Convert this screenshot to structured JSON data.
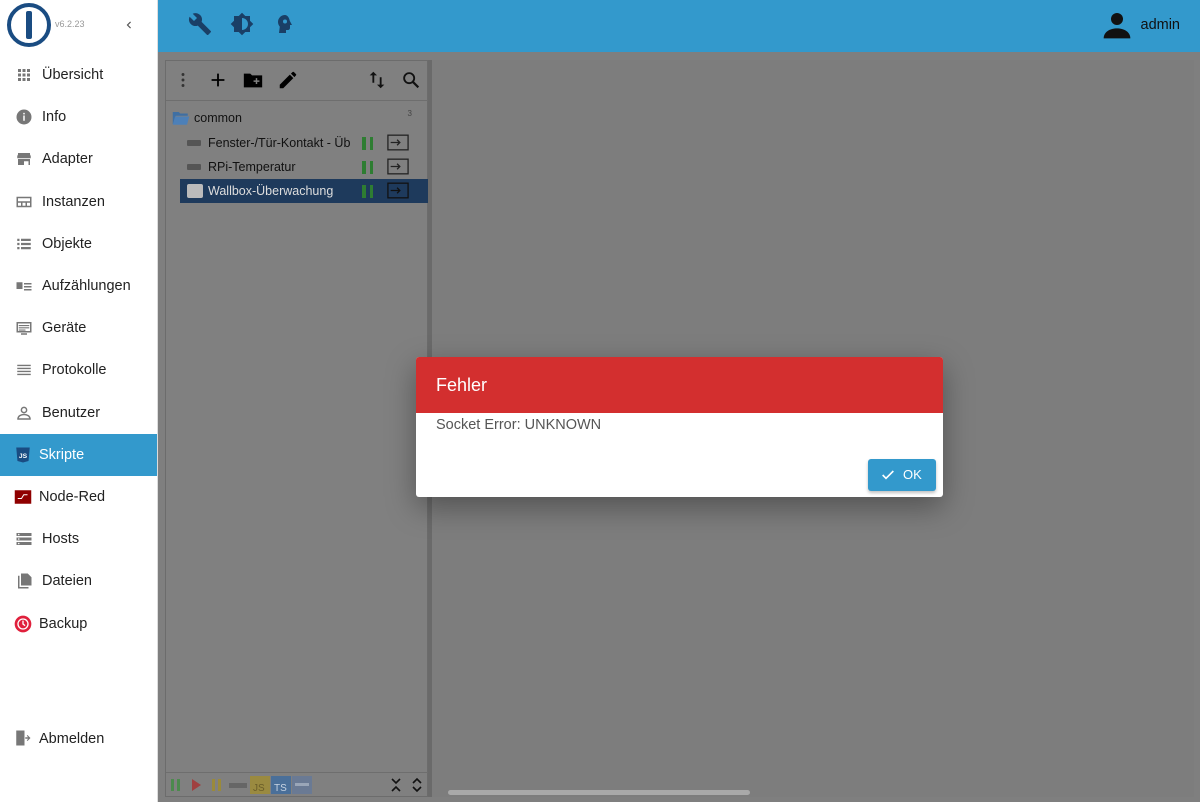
{
  "app": {
    "version": "v6.2.23"
  },
  "sidebar": {
    "items": [
      {
        "label": "Übersicht",
        "icon": "grid-icon"
      },
      {
        "label": "Info",
        "icon": "info-icon"
      },
      {
        "label": "Adapter",
        "icon": "store-icon"
      },
      {
        "label": "Instanzen",
        "icon": "instances-icon"
      },
      {
        "label": "Objekte",
        "icon": "list-icon"
      },
      {
        "label": "Aufzählungen",
        "icon": "enum-icon"
      },
      {
        "label": "Geräte",
        "icon": "devices-icon"
      },
      {
        "label": "Protokolle",
        "icon": "log-icon"
      },
      {
        "label": "Benutzer",
        "icon": "user-icon"
      },
      {
        "label": "Skripte",
        "icon": "javascript-icon",
        "active": true
      },
      {
        "label": "Node-Red",
        "icon": "node-red-icon"
      },
      {
        "label": "Hosts",
        "icon": "hosts-icon"
      },
      {
        "label": "Dateien",
        "icon": "files-icon"
      },
      {
        "label": "Backup",
        "icon": "backup-icon"
      }
    ],
    "logout_label": "Abmelden"
  },
  "topbar": {
    "icons": [
      "wrench-icon",
      "brightness-icon",
      "expert-mode-icon"
    ],
    "user_name": "admin"
  },
  "scripts": {
    "folder": {
      "label": "common",
      "count": "3"
    },
    "items": [
      {
        "label": "Fenster-/Tür-Kontakt - Üb",
        "selected": false
      },
      {
        "label": "RPi-Temperatur",
        "selected": false
      },
      {
        "label": "Wallbox-Überwachung",
        "selected": true
      }
    ]
  },
  "dialog": {
    "title": "Fehler",
    "message": "Socket Error: UNKNOWN",
    "ok_label": "OK"
  },
  "colors": {
    "primary": "#3399cc",
    "error": "#d32f2f",
    "selected_row": "#1e3a5c"
  }
}
